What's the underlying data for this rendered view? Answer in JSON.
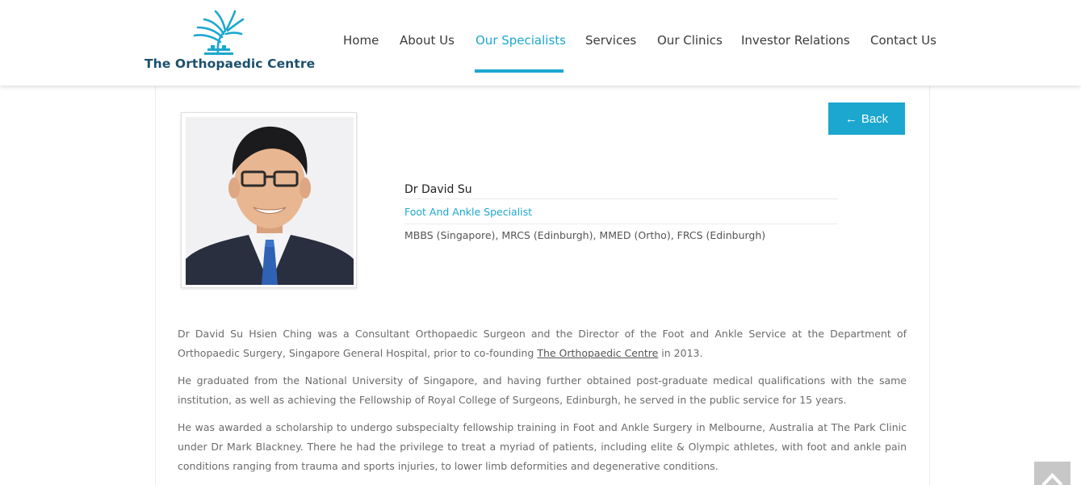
{
  "brand": {
    "name": "The Orthopaedic Centre"
  },
  "nav": {
    "items": [
      {
        "label": "Home"
      },
      {
        "label": "About Us"
      },
      {
        "label": "Our Specialists",
        "active": true
      },
      {
        "label": "Services"
      },
      {
        "label": "Our Clinics"
      },
      {
        "label": "Investor Relations"
      },
      {
        "label": "Contact Us"
      }
    ]
  },
  "back_button": {
    "arrow": "←",
    "label": "Back"
  },
  "doctor": {
    "name": "Dr David Su",
    "specialty": "Foot And Ankle Specialist",
    "qualifications": "MBBS (Singapore), MRCS (Edinburgh), MMED (Ortho), FRCS (Edinburgh)"
  },
  "bio": {
    "p1_before": "Dr David Su Hsien Ching was a Consultant Orthopaedic Surgeon and the Director of the Foot and Ankle Service at the Department of Orthopaedic Surgery, Singapore General Hospital, prior to co-founding ",
    "p1_link": "The Orthopaedic Centre",
    "p1_after": " in 2013.",
    "p2": "He graduated from the National University of Singapore, and having further obtained post-graduate medical qualifications with the same institution, as well as achieving the Fellowship of Royal College of Surgeons, Edinburgh, he served in the public service for 15 years.",
    "p3": "He was awarded a scholarship to undergo subspecialty fellowship training in Foot and Ankle Surgery in Melbourne, Australia at The Park Clinic under Dr Mark Blackney. There he had the privilege to treat a myriad of patients, including elite & Olympic athletes, with foot and ankle pain conditions ranging from trauma and sports injuries, to lower limb deformities and degenerative conditions."
  },
  "colors": {
    "accent": "#1ca7cf",
    "brand_text": "#1c4f6e"
  },
  "icons": {
    "scroll_top": "chevron-up-icon",
    "logo": "tree-logo-icon"
  }
}
